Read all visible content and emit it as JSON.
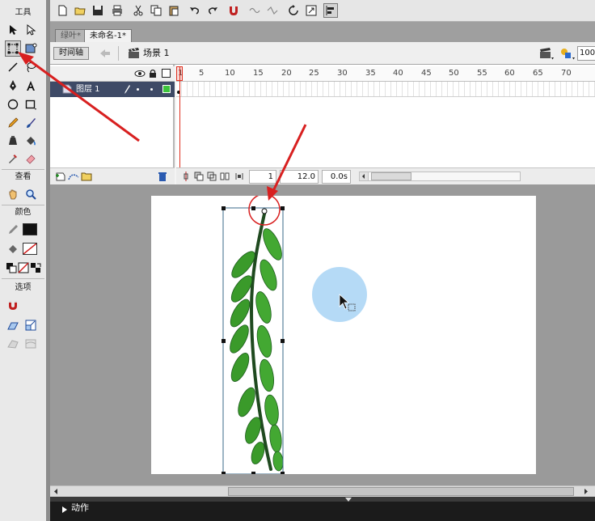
{
  "tools_panel": {
    "tools_header": "工具",
    "view_header": "查看",
    "colors_header": "颜色",
    "options_header": "选项",
    "colors": {
      "stroke": "#111111",
      "fill": "#1a6b1a"
    }
  },
  "document_tabs": [
    {
      "label": "绿叶*"
    },
    {
      "label": "未命名-1*"
    }
  ],
  "edit_bar": {
    "timeline_button": "时间轴",
    "scene_label": "场景 1",
    "zoom_value": "100"
  },
  "timeline": {
    "ruler_labels": [
      "1",
      "5",
      "10",
      "15",
      "20",
      "25",
      "30",
      "35",
      "40",
      "45",
      "50",
      "55",
      "60",
      "65",
      "70"
    ],
    "layer_name": "图层 1",
    "current_frame": "1",
    "frame_rate": "12.0 fps",
    "elapsed_time": "0.0s"
  },
  "actions_panel": {
    "title": "动作"
  }
}
